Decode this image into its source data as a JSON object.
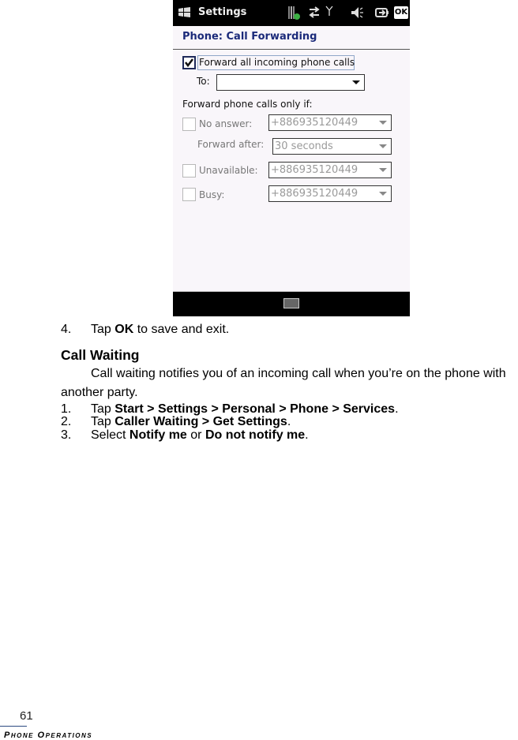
{
  "phone_screen": {
    "topbar": {
      "title": "Settings",
      "status_icons": [
        "signal-bars-icon",
        "data-transfer-icon",
        "antenna-icon",
        "speaker-icon",
        "battery-icon"
      ],
      "ok_label": "OK"
    },
    "page_header": "Phone: Call Forwarding",
    "forward_all": {
      "label": "Forward all incoming phone calls",
      "checked": true
    },
    "to": {
      "label": "To:",
      "value": ""
    },
    "section_label": "Forward phone calls only if:",
    "conditions": [
      {
        "label": "No answer:",
        "checked": false,
        "value": "+886935120449"
      },
      {
        "label": "Unavailable:",
        "checked": false,
        "value": "+886935120449"
      },
      {
        "label": "Busy:",
        "checked": false,
        "value": "+886935120449"
      }
    ],
    "forward_after": {
      "label": "Forward after:",
      "value": "30 seconds"
    },
    "bottombar": {
      "icon": "keyboard-icon"
    }
  },
  "document": {
    "step4": {
      "num": "4.",
      "pre": "Tap ",
      "bold": "OK",
      "post": " to save and exit."
    },
    "heading": "Call Waiting",
    "paragraph_line1": "Call waiting notifies you of an incoming call when you’re on the phone with",
    "paragraph_line2": "another party.",
    "steps": [
      {
        "num": "1.",
        "pre": "Tap ",
        "bold": "Start > Settings > Personal > Phone > Services",
        "post": "."
      },
      {
        "num": "2.",
        "pre": "Tap ",
        "bold": "Caller Waiting > Get Settings",
        "post": "."
      },
      {
        "num": "3.",
        "pre": "Select ",
        "bold": "Notify me",
        "mid": " or ",
        "bold2": "Do not notify me",
        "post": "."
      }
    ]
  },
  "footer": {
    "page_number": "61",
    "section_title": "Phone Operations"
  }
}
